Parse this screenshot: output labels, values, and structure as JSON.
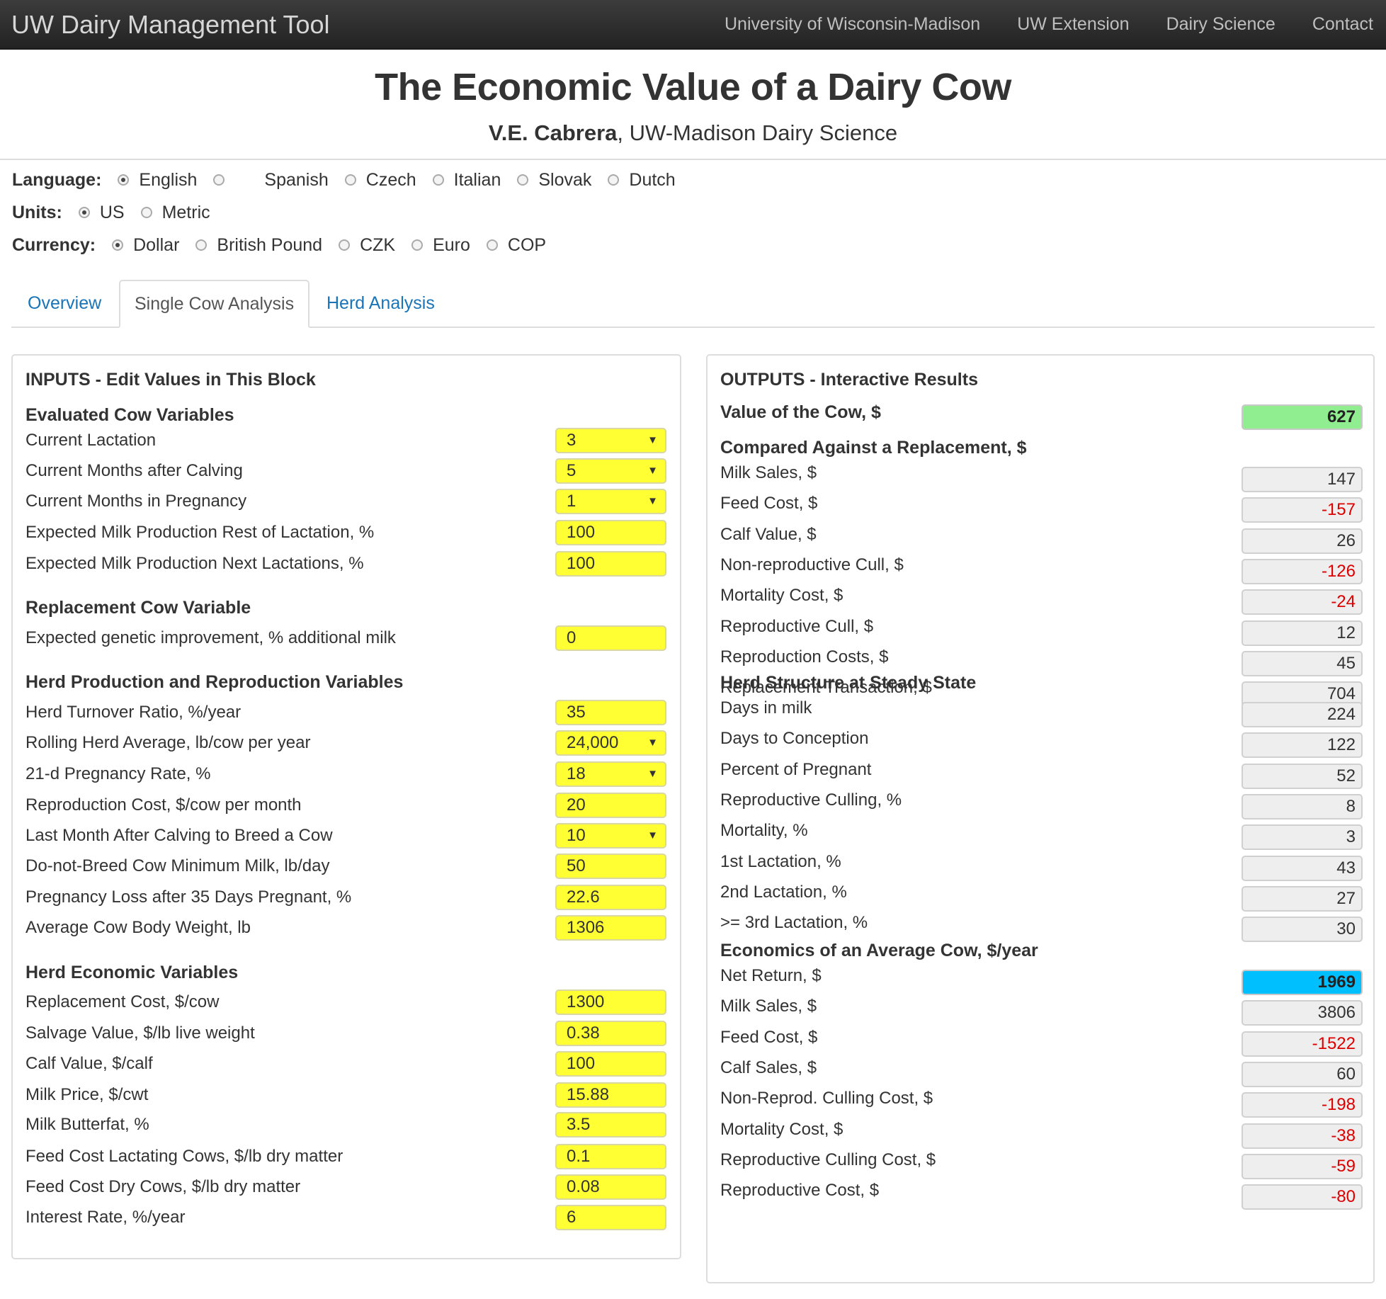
{
  "nav": {
    "brand": "UW Dairy Management Tool",
    "links": [
      "University of Wisconsin-Madison",
      "UW Extension",
      "Dairy Science",
      "Contact"
    ]
  },
  "header": {
    "title": "The Economic Value of a Dairy Cow",
    "author": "V.E. Cabrera",
    "affiliation": ", UW-Madison Dairy Science"
  },
  "options": {
    "language_label": "Language:",
    "languages": [
      "English",
      "Spanish",
      "Czech",
      "Italian",
      "Slovak",
      "Dutch"
    ],
    "language_selected": "English",
    "units_label": "Units:",
    "units": [
      "US",
      "Metric"
    ],
    "units_selected": "US",
    "currency_label": "Currency:",
    "currencies": [
      "Dollar",
      "British Pound",
      "CZK",
      "Euro",
      "COP"
    ],
    "currency_selected": "Dollar"
  },
  "tabs": [
    "Overview",
    "Single Cow Analysis",
    "Herd Analysis"
  ],
  "tab_active": "Single Cow Analysis",
  "inputs": {
    "heading": "INPUTS - Edit Values in This Block",
    "sections": [
      {
        "title": "Evaluated Cow Variables",
        "rows": [
          {
            "label": "Current Lactation",
            "value": "3",
            "select": true
          },
          {
            "label": "Current Months after Calving",
            "value": "5",
            "select": true
          },
          {
            "label": "Current Months in Pregnancy",
            "value": "1",
            "select": true
          },
          {
            "label": "Expected Milk Production Rest of Lactation, %",
            "value": "100",
            "select": false
          },
          {
            "label": "Expected Milk Production Next Lactations, %",
            "value": "100",
            "select": false
          }
        ]
      },
      {
        "title": "Replacement Cow Variable",
        "rows": [
          {
            "label": "Expected genetic improvement, % additional milk",
            "value": "0",
            "select": false
          }
        ]
      },
      {
        "title": "Herd Production and Reproduction Variables",
        "rows": [
          {
            "label": "Herd Turnover Ratio, %/year",
            "value": "35",
            "select": false
          },
          {
            "label": "Rolling Herd Average, lb/cow per year",
            "value": "24,000",
            "select": true
          },
          {
            "label": "21-d Pregnancy Rate, %",
            "value": "18",
            "select": true
          },
          {
            "label": "Reproduction Cost, $/cow per month",
            "value": "20",
            "select": false
          },
          {
            "label": "Last Month After Calving to Breed a Cow",
            "value": "10",
            "select": true
          },
          {
            "label": "Do-not-Breed Cow Minimum Milk, lb/day",
            "value": "50",
            "select": false
          },
          {
            "label": "Pregnancy Loss after 35 Days Pregnant, %",
            "value": "22.6",
            "select": false
          },
          {
            "label": "Average Cow Body Weight, lb",
            "value": "1306",
            "select": false
          }
        ]
      },
      {
        "title": "Herd Economic Variables",
        "rows": [
          {
            "label": "Replacement Cost, $/cow",
            "value": "1300",
            "select": false
          },
          {
            "label": "Salvage Value, $/lb live weight",
            "value": "0.38",
            "select": false
          },
          {
            "label": "Calf Value, $/calf",
            "value": "100",
            "select": false
          },
          {
            "label": "Milk Price, $/cwt",
            "value": "15.88",
            "select": false
          },
          {
            "label": "Milk Butterfat, %",
            "value": "3.5",
            "select": false
          },
          {
            "label": "Feed Cost Lactating Cows, $/lb dry matter",
            "value": "0.1",
            "select": false
          },
          {
            "label": "Feed Cost Dry Cows, $/lb dry matter",
            "value": "0.08",
            "select": false
          },
          {
            "label": "Interest Rate, %/year",
            "value": "6",
            "select": false
          }
        ]
      }
    ]
  },
  "outputs": {
    "heading": "OUTPUTS - Interactive Results",
    "value_label": "Value of the Cow, $",
    "value": "627",
    "value_color": "#90ee90",
    "sections": [
      {
        "title": "Compared Against a Replacement, $",
        "rows": [
          {
            "label": "Milk Sales, $",
            "value": "147"
          },
          {
            "label": "Feed Cost, $",
            "value": "-157"
          },
          {
            "label": "Calf Value, $",
            "value": "26"
          },
          {
            "label": "Non-reproductive Cull, $",
            "value": "-126"
          },
          {
            "label": "Mortality Cost, $",
            "value": "-24"
          },
          {
            "label": "Reproductive Cull, $",
            "value": "12"
          },
          {
            "label": "Reproduction Costs, $",
            "value": "45"
          },
          {
            "label": "Replacement Transaction, $",
            "value": "704"
          }
        ]
      },
      {
        "title": "Herd Structure at Steady State",
        "rows": [
          {
            "label": "Days in milk",
            "value": "224"
          },
          {
            "label": "Days to Conception",
            "value": "122"
          },
          {
            "label": "Percent of Pregnant",
            "value": "52"
          },
          {
            "label": "Reproductive Culling, %",
            "value": "8"
          },
          {
            "label": "Mortality, %",
            "value": "3"
          },
          {
            "label": "1st Lactation, %",
            "value": "43"
          },
          {
            "label": "2nd Lactation, %",
            "value": "27"
          },
          {
            "label": ">= 3rd Lactation, %",
            "value": "30"
          }
        ]
      },
      {
        "title": "Economics of an Average Cow, $/year",
        "rows": [
          {
            "label": "Net Return, $",
            "value": "1969",
            "highlight": "blue"
          },
          {
            "label": "Milk Sales, $",
            "value": "3806"
          },
          {
            "label": "Feed Cost, $",
            "value": "-1522"
          },
          {
            "label": "Calf Sales, $",
            "value": "60"
          },
          {
            "label": "Non-Reprod. Culling Cost, $",
            "value": "-198"
          },
          {
            "label": "Mortality Cost, $",
            "value": "-38"
          },
          {
            "label": "Reproductive Culling Cost, $",
            "value": "-59"
          },
          {
            "label": "Reproductive Cost, $",
            "value": "-80"
          }
        ]
      }
    ],
    "highlight_colors": {
      "blue": "#00bfff",
      "negative": "#dd0000"
    }
  }
}
